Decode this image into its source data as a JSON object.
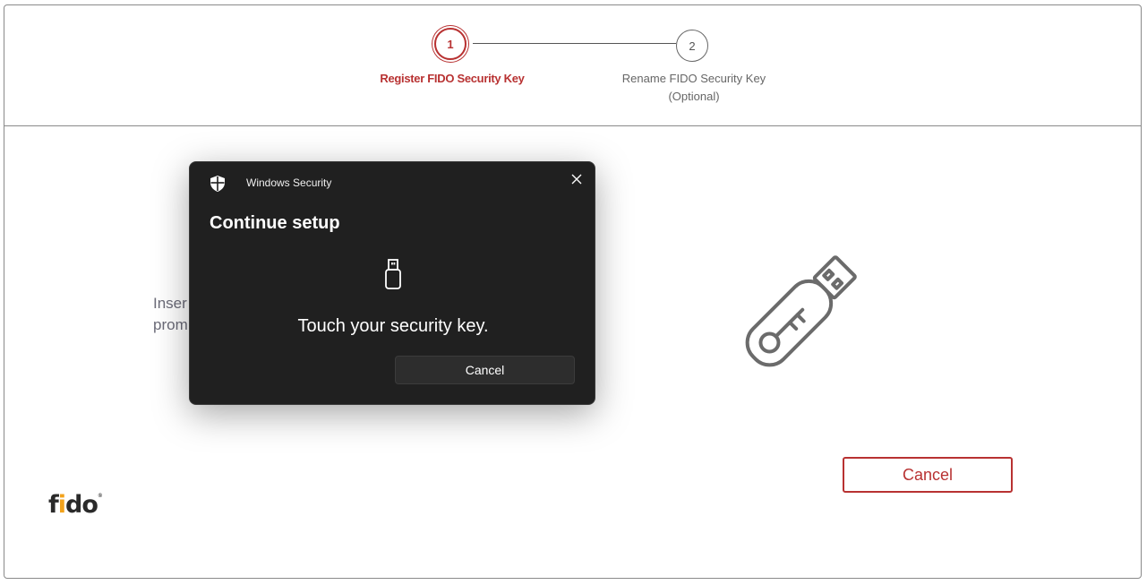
{
  "stepper": {
    "steps": [
      {
        "number": "1",
        "label": "Register FIDO Security Key",
        "state": "active"
      },
      {
        "number": "2",
        "label": "Rename FIDO Security Key",
        "sublabel": "(Optional)",
        "state": "pending"
      }
    ]
  },
  "main": {
    "instruction_line1": "Inser",
    "instruction_line2": "prom",
    "cancel_label": "Cancel"
  },
  "logo": {
    "text_main": "f",
    "text_i": "i",
    "text_do": "do",
    "trademark": "®"
  },
  "dialog": {
    "app_title": "Windows Security",
    "heading": "Continue setup",
    "message": "Touch your security key.",
    "cancel_label": "Cancel"
  },
  "colors": {
    "accent": "#b83232",
    "dialog_bg": "#202020",
    "fido_accent": "#f2a21b"
  },
  "icons": [
    "shield-icon",
    "close-icon",
    "usb-key-icon",
    "usb-security-key-illustration"
  ]
}
